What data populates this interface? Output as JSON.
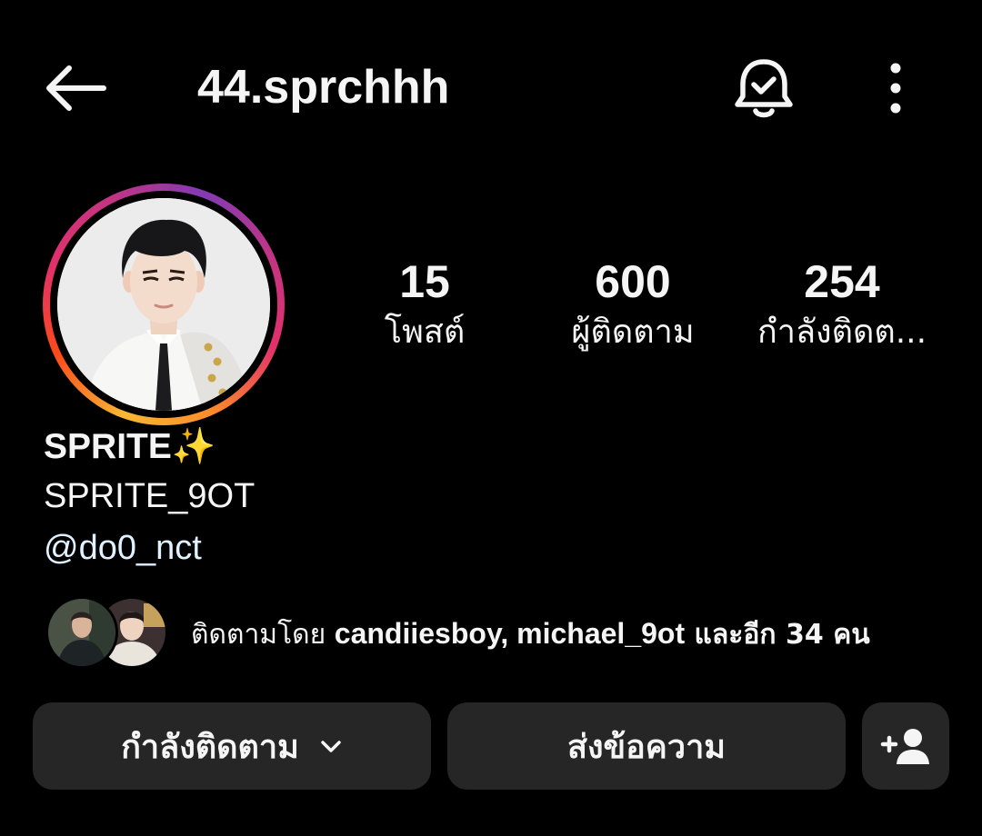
{
  "header": {
    "username": "44.sprchhh",
    "icons": {
      "back": "arrow-left-icon",
      "notifications": "bell-check-icon",
      "more": "more-vertical-icon"
    }
  },
  "profile": {
    "avatar": "profile-photo",
    "stats": [
      {
        "number": "15",
        "label": "โพสต์"
      },
      {
        "number": "600",
        "label": "ผู้ติดตาม"
      },
      {
        "number": "254",
        "label": "กำลังติดต..."
      }
    ],
    "display_name": "SPRITE",
    "display_name_emoji": "✨",
    "bio_line": "SPRITE_9OT",
    "mention": "@do0_nct"
  },
  "mutual": {
    "prefix": "ติดตามโดย ",
    "users": "candiiesboy, michael_9ot",
    "suffix": " และอีก 34 คน"
  },
  "actions": {
    "following_label": "กำลังติดตาม",
    "message_label": "ส่งข้อความ",
    "add_friend_icon": "add-person-icon"
  },
  "colors": {
    "background": "#000000",
    "button_bg": "#262626",
    "text": "#f5f5f5",
    "mention": "#e0f1ff",
    "story_ring_start": "#f7b733",
    "story_ring_end": "#c13584"
  }
}
